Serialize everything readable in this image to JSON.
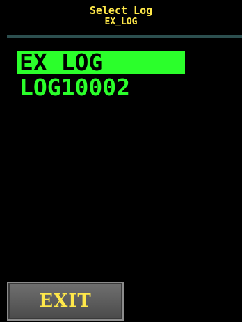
{
  "header": {
    "title": "Select Log",
    "current_log": "EX_LOG"
  },
  "logs": [
    {
      "label": "EX LOG",
      "selected": true
    },
    {
      "label": "LOG10002",
      "selected": false
    }
  ],
  "buttons": {
    "exit_label": "EXIT"
  },
  "colors": {
    "header_text": "#ffe84a",
    "list_text": "#2bff2b",
    "selection_bg": "#2bff2b",
    "background": "#000000"
  }
}
